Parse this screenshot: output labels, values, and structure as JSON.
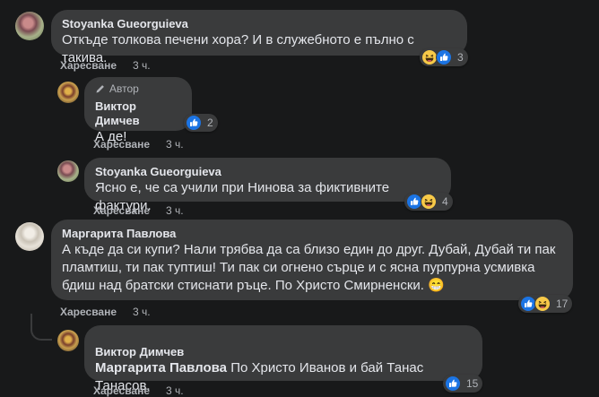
{
  "comments": [
    {
      "author": "Stoyanka Gueorguieva",
      "text": "Откъде толкова печени хора? И в служебното е пълно с такива.",
      "like_label": "Харесване",
      "time": "3 ч.",
      "reaction_count": "3",
      "reactions": [
        "haha-icon",
        "like-icon"
      ]
    },
    {
      "badge": "Автор",
      "author": "Виктор Димчев",
      "text": "А де!",
      "like_label": "Харесване",
      "time": "3 ч.",
      "reaction_count": "2",
      "reactions": [
        "like-icon"
      ]
    },
    {
      "author": "Stoyanka Gueorguieva",
      "text": "Ясно е, че са учили при Нинова за фиктивните фактури.",
      "like_label": "Харесване",
      "time": "3 ч.",
      "reaction_count": "4",
      "reactions": [
        "like-icon",
        "haha-icon"
      ]
    },
    {
      "author": "Маргарита Павлова",
      "text": "А къде да си купи? Нали трябва да са близо един до друг. Дубай, Дубай ти пак пламтиш, ти пак туптиш! Ти пак си огнено сърце и с ясна пурпурна усмивка бдиш над братски стиснати ръце. По Христо Смирненски. 😁",
      "like_label": "Харесване",
      "time": "3 ч.",
      "reaction_count": "17",
      "reactions": [
        "like-icon",
        "haha-icon"
      ]
    },
    {
      "author": "Виктор Димчев",
      "mention": "Маргарита Павлова",
      "text": " По Христо Иванов и бай Танас Танасов.",
      "like_label": "Харесване",
      "time": "3 ч.",
      "reaction_count": "15",
      "reactions": [
        "like-icon"
      ]
    }
  ]
}
